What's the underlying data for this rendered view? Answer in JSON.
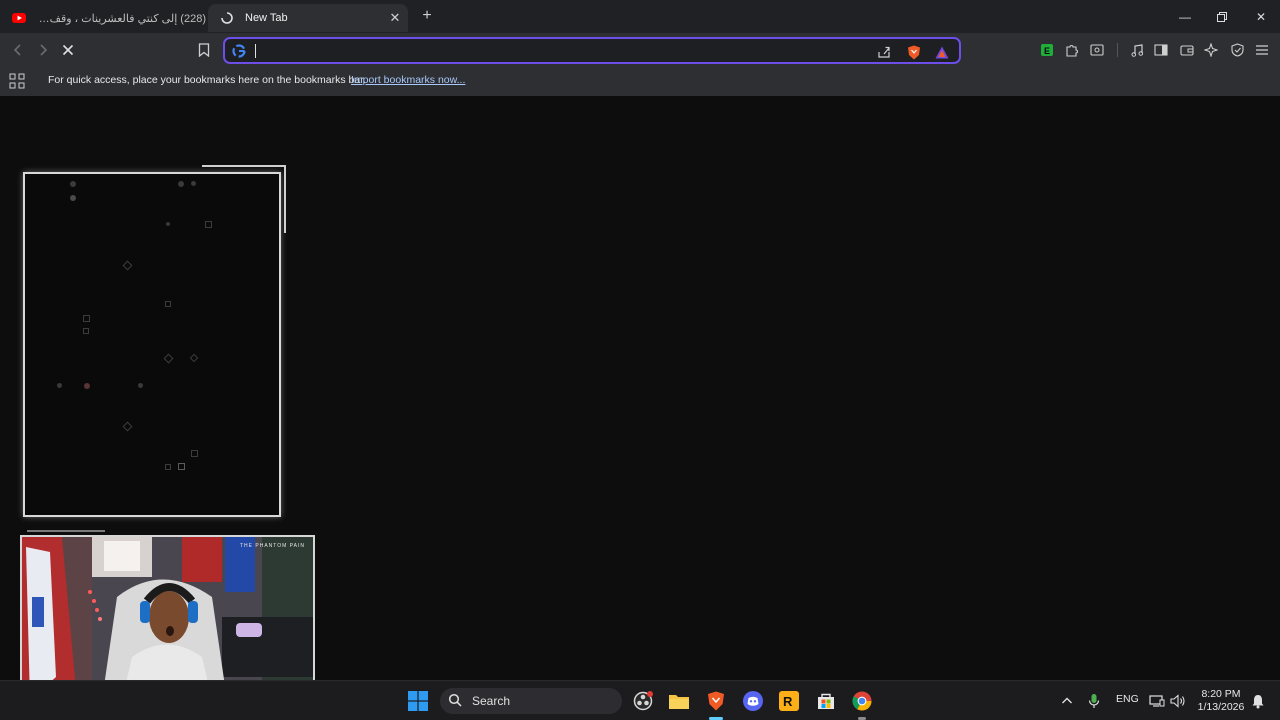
{
  "browser": {
    "tabs": [
      {
        "title": "(228) إلى كنتي فالعشرينات ، وقف... ما",
        "favicon": "youtube-icon",
        "active": false
      },
      {
        "title": "New Tab",
        "favicon": "loading-icon",
        "active": true
      }
    ],
    "omnibox": {
      "value": "",
      "placeholder": ""
    },
    "bookmarks_bar": {
      "message": "For quick access, place your bookmarks here on the bookmarks bar.",
      "import_link": "Import bookmarks now..."
    },
    "accent": "#6d4ee8"
  },
  "webcam": {
    "label": "THE PHANTOM PAIN"
  },
  "taskbar": {
    "search_label": "Search",
    "language": "ENG",
    "time": "8:20 PM",
    "date": "1/13/2026"
  }
}
